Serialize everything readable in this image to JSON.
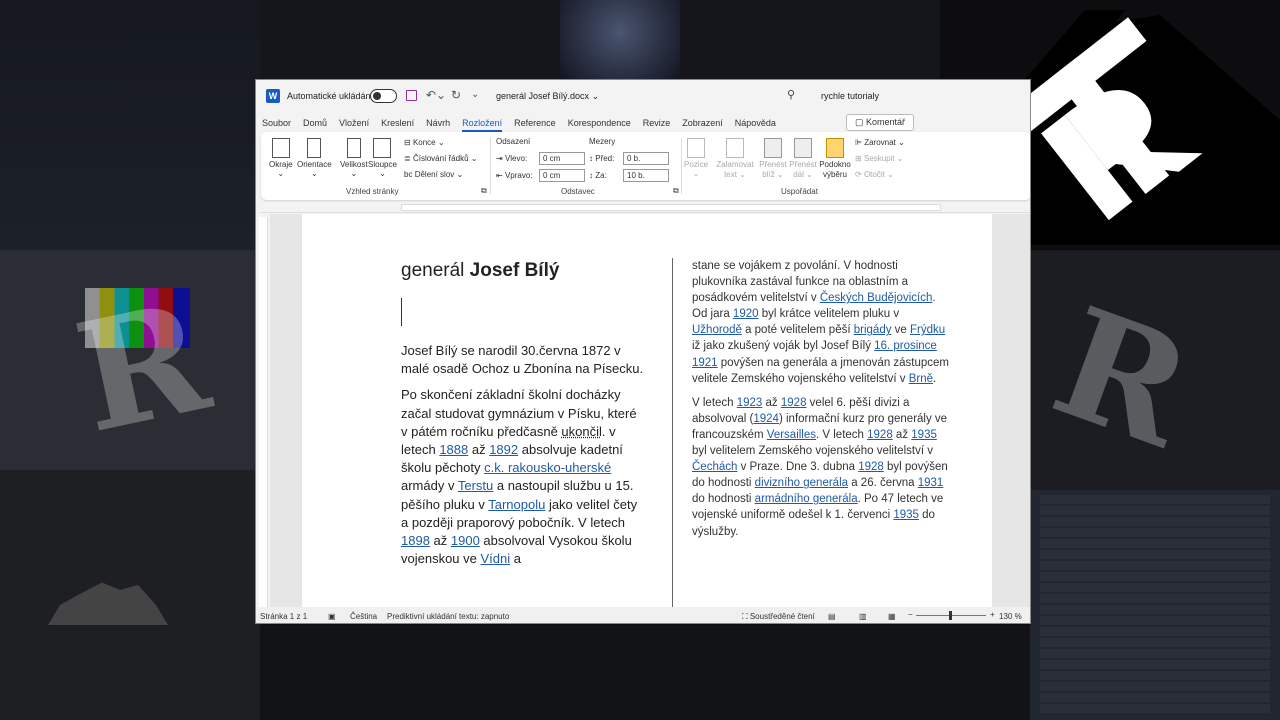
{
  "window": {
    "autosave_label": "Automatické ukládání",
    "doc_title": "generál Josef Bílý.docx",
    "user": "rychle tutorialy"
  },
  "tabs": [
    "Soubor",
    "Domů",
    "Vložení",
    "Kreslení",
    "Návrh",
    "Rozložení",
    "Reference",
    "Korespondence",
    "Revize",
    "Zobrazení",
    "Nápověda"
  ],
  "active_tab": "Rozložení",
  "comments_label": "Komentář",
  "ribbon": {
    "page_setup": {
      "margins": "Okraje",
      "orientation": "Orientace",
      "size": "Velikost",
      "columns": "Sloupce",
      "breaks": "Konce",
      "line_numbers": "Číslování řádků",
      "hyphenation": "Dělení slov",
      "group_label": "Vzhled stránky"
    },
    "paragraph": {
      "indent_label": "Odsazení",
      "spacing_label": "Mezery",
      "left_label": "Vlevo:",
      "left_value": "0 cm",
      "right_label": "Vpravo:",
      "right_value": "0 cm",
      "before_label": "Před:",
      "before_value": "0 b.",
      "after_label": "Za:",
      "after_value": "10 b.",
      "group_label": "Odstavec"
    },
    "arrange": {
      "position": "Pozice",
      "wrap": "Zalamovat text",
      "forward": "Přenést blíž",
      "backward": "Přenést dál",
      "selection_pane": "Podokno výběru",
      "align": "Zarovnat",
      "group": "Seskupit",
      "rotate": "Otočit",
      "group_label": "Uspořádat"
    }
  },
  "document": {
    "heading_normal": "generál ",
    "heading_bold": "Josef Bílý",
    "col1": {
      "p1": "Josef Bílý se narodil 30.června 1872 v malé osadě Ochoz u Zbonína na Písecku.",
      "p2_a": "Po skončení základní školní docházky začal studovat gymnázium v Písku, které v pátém ročníku předčasně ",
      "p2_b": "ukončil",
      "p2_c": ". v letech ",
      "link_1888": "1888",
      "p2_d": " až ",
      "link_1892": "1892",
      "p2_e": " absolvuje kadetní školu pěchoty ",
      "link_kadet": "c.k. rakousko-uherské",
      "p2_f": " armády v ",
      "link_terst": "Terstu",
      "p2_g": " a nastoupil službu u 15. pěšího pluku v ",
      "link_tarnopol": "Tarnopolu",
      "p2_h": " jako velitel čety a později praporový pobočník. V letech ",
      "link_1898": "1898",
      "p2_i": " až ",
      "link_1900": "1900",
      "p2_j": " absolvoval Vysokou školu vojenskou ve ",
      "link_viden": "Vídni",
      "p2_k": " a"
    },
    "col2": {
      "a": "stane se vojákem z povolání.   V hodnosti plukovníka zastával funkce na oblastním a posádkovém velitelství v ",
      "link_cb": "Českých Budějovicích",
      "b": ". Od jara ",
      "link_1920": "1920",
      "c": " byl krátce velitelem pluku v ",
      "link_uzhorod": "Užhorodě",
      "d": " a poté velitelem pěší ",
      "link_brigady": "brigády",
      "e": " ve ",
      "link_frydek": "Frýdku",
      "f": "  iž jako zkušený voják byl Josef Bílý ",
      "link_prosinec": "16. prosince",
      "g": " ",
      "link_1921": "1921",
      "h": " povýšen na generála a jmenován zástupcem velitele Zemského vojenského velitelství v ",
      "link_brno": "Brně",
      "i": ".",
      "p2_a": "V letech ",
      "link_1923": "1923",
      "p2_b": " až ",
      "link_1928": "1928",
      "p2_c": " velel 6. pěší divizi a absolvoval (",
      "link_1924": "1924",
      "p2_d": ") informační kurz pro generály ve francouzském ",
      "link_versailles": "Versailles",
      "p2_e": ". V letech ",
      "link_1928b": "1928",
      "p2_f": " až ",
      "link_1935": "1935",
      "p2_g": " byl velitelem Zemského vojenského velitelství v ",
      "link_cechy": "Čechách",
      "p2_h": " v Praze. Dne 3. dubna ",
      "link_1928c": "1928",
      "p2_i": " byl povýšen do hodnosti ",
      "link_divizni": "divizního generála",
      "p2_j": " a 26. června ",
      "link_1931": "1931",
      "p2_k": " do hodnosti ",
      "link_armadni": "armádního generála",
      "p2_l": ". Po 47 letech ve vojenské uniformě odešel k 1. červenci ",
      "link_1935b": "1935",
      "p2_m": " do výslužby."
    }
  },
  "status": {
    "page": "Stránka 1 z 1",
    "language": "Čeština",
    "predictive": "Prediktivní ukládání textu: zapnuto",
    "focus": "Soustředěné čtení",
    "zoom": "130 %"
  },
  "icons": [
    "word-icon",
    "save-icon",
    "undo-icon",
    "redo-icon",
    "search-icon",
    "margins-icon",
    "orientation-icon",
    "size-icon",
    "columns-icon",
    "selection-pane-icon"
  ]
}
